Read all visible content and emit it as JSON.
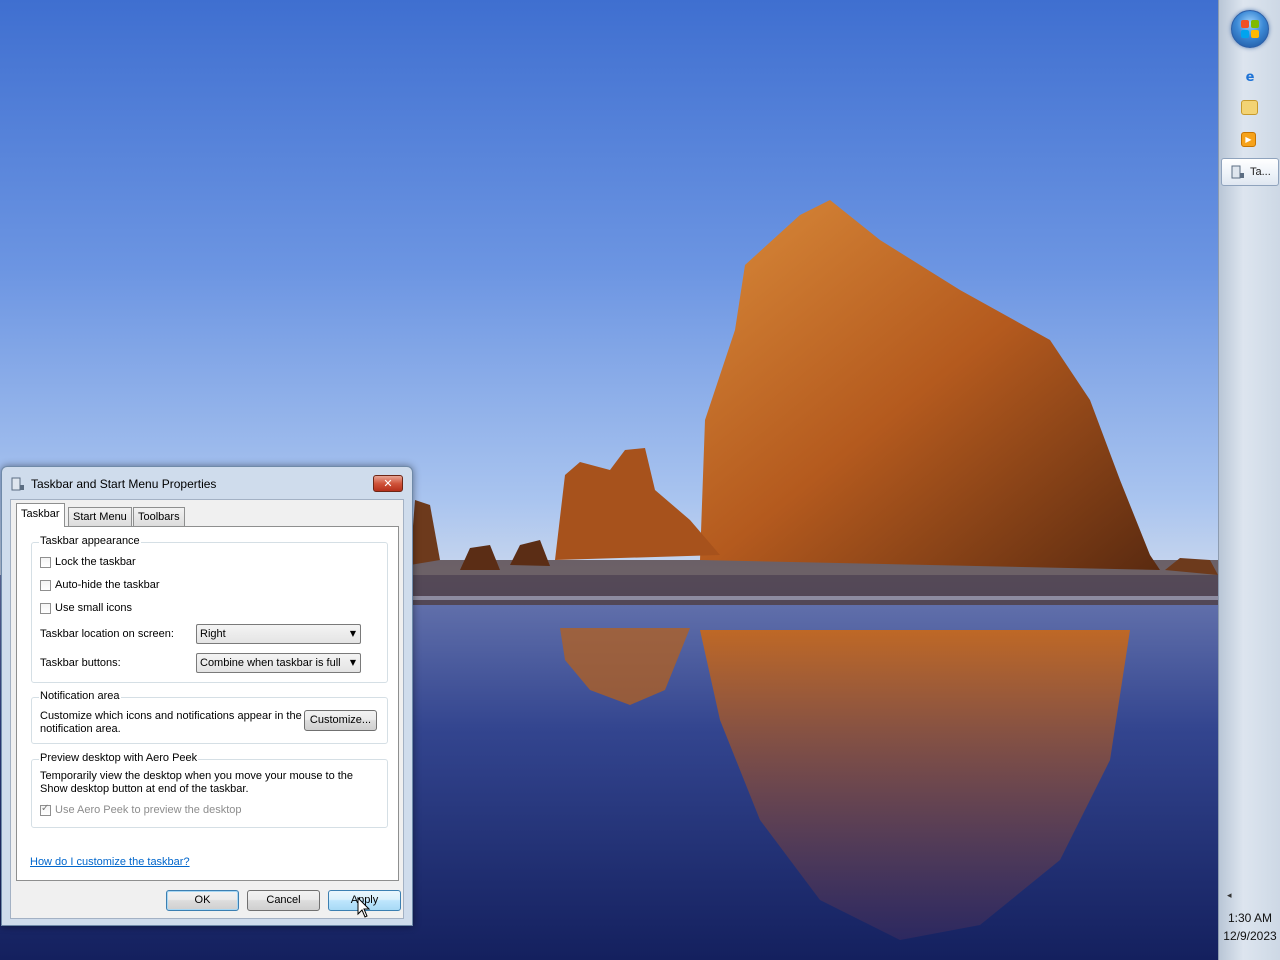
{
  "dialog": {
    "title": "Taskbar and Start Menu Properties",
    "close_label": "✕",
    "tabs": [
      {
        "label": "Taskbar",
        "active": true
      },
      {
        "label": "Start Menu",
        "active": false
      },
      {
        "label": "Toolbars",
        "active": false
      }
    ],
    "appearance": {
      "title": "Taskbar appearance",
      "lock_label": "Lock the taskbar",
      "lock_checked": false,
      "autohide_label": "Auto-hide the taskbar",
      "autohide_checked": false,
      "small_icons_label": "Use small icons",
      "small_icons_checked": false,
      "location_label": "Taskbar location on screen:",
      "location_value": "Right",
      "buttons_label": "Taskbar buttons:",
      "buttons_value": "Combine when taskbar is full"
    },
    "notification": {
      "title": "Notification area",
      "text_line1": "Customize which icons and notifications appear in the",
      "text_line2": "notification area.",
      "customize_label": "Customize..."
    },
    "aero_peek": {
      "title": "Preview desktop with Aero Peek",
      "text_line1": "Temporarily view the desktop when you move your mouse to the",
      "text_line2": "Show desktop button at end of the taskbar.",
      "checkbox_label": "Use Aero Peek to preview the desktop",
      "checkbox_checked": true,
      "checkbox_disabled": true
    },
    "help_link": "How do I customize the taskbar?",
    "buttons": {
      "ok": "OK",
      "cancel": "Cancel",
      "apply": "Apply"
    }
  },
  "taskbar": {
    "position": "right",
    "pinned": [
      {
        "icon": "internet-explorer-icon"
      },
      {
        "icon": "windows-explorer-icon"
      },
      {
        "icon": "media-player-icon"
      }
    ],
    "task_label": "Ta...",
    "tray_arrow": "◂",
    "clock_time": "1:30 AM",
    "clock_date": "12/9/2023"
  },
  "colors": {
    "link": "#0066cc",
    "close_button": "#c7452d",
    "taskbar": "#d3dce8"
  }
}
